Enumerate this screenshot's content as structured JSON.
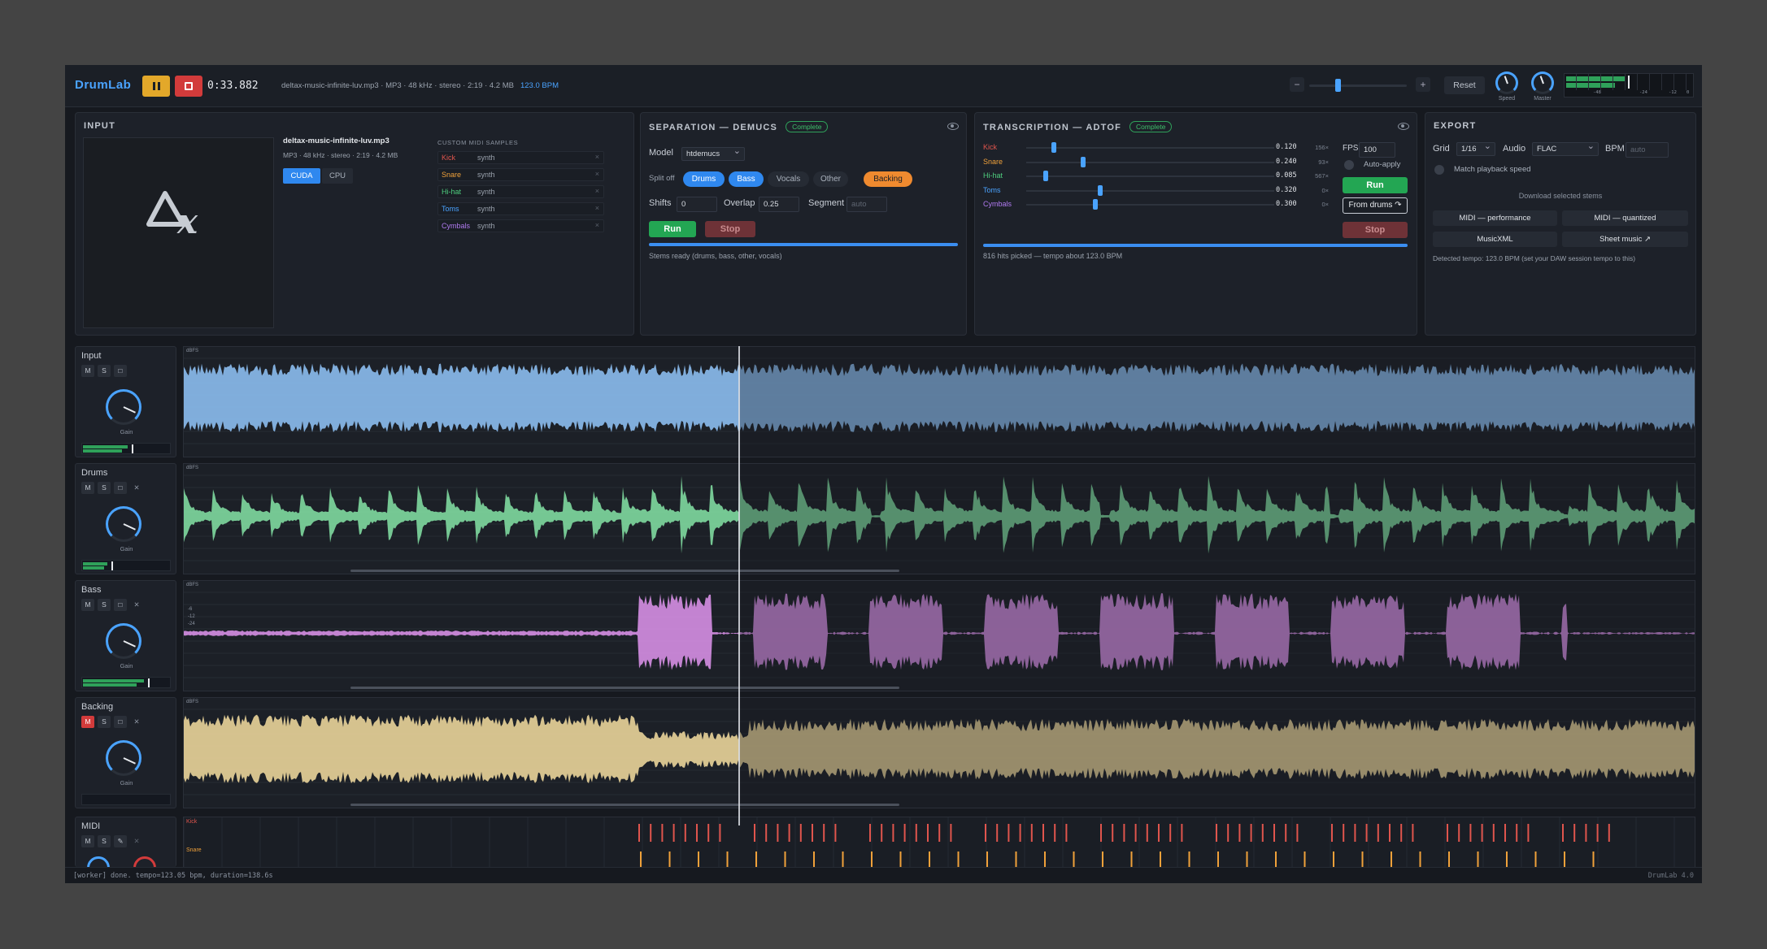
{
  "app": {
    "brand": "DrumLab",
    "time": "0:33.882",
    "file_info": "deltax-music-infinite-luv.mp3 · MP3 · 48 kHz · stereo · 2:19 · 4.2 MB",
    "bpm": "123.0 BPM",
    "reset": "Reset",
    "zoom_minus": "−",
    "zoom_plus": "+",
    "speed_label": "Speed",
    "master_label": "Master",
    "meter_ticks": [
      "-48",
      "-24",
      "-12",
      "0"
    ]
  },
  "input": {
    "title": "INPUT",
    "filename": "deltax-music-infinite-luv.mp3",
    "meta": "MP3 · 48 kHz · stereo · 2:19 · 4.2 MB",
    "cuda": "CUDA",
    "cpu": "CPU",
    "logo_text": "Δx",
    "samples_title": "CUSTOM MIDI SAMPLES",
    "samples": [
      {
        "name": "Kick",
        "value": "synth",
        "color": "#e0554d"
      },
      {
        "name": "Snare",
        "value": "synth",
        "color": "#f0a13a"
      },
      {
        "name": "Hi-hat",
        "value": "synth",
        "color": "#4fd07f"
      },
      {
        "name": "Toms",
        "value": "synth",
        "color": "#4aa3ff"
      },
      {
        "name": "Cymbals",
        "value": "synth",
        "color": "#b07af0"
      }
    ]
  },
  "separation": {
    "title": "SEPARATION — DEMUCS",
    "status": "Complete",
    "model_label": "Model",
    "model": "htdemucs",
    "split_label": "Split off",
    "splits": [
      "Drums",
      "Bass",
      "Vocals",
      "Other",
      "Backing"
    ],
    "shifts_label": "Shifts",
    "shifts": "0",
    "overlap_label": "Overlap",
    "overlap": "0.25",
    "segment_label": "Segment",
    "segment_ph": "auto",
    "run": "Run",
    "stop": "Stop",
    "progress": 1.0,
    "note": "Stems ready (drums, bass, other, vocals)"
  },
  "transcription": {
    "title": "TRANSCRIPTION — ADTOF",
    "status": "Complete",
    "rows": [
      {
        "name": "Kick",
        "value": "0.120",
        "hits": "156×",
        "color": "#e0554d",
        "pos": 0.1
      },
      {
        "name": "Snare",
        "value": "0.240",
        "hits": "93×",
        "color": "#f0a13a",
        "pos": 0.22
      },
      {
        "name": "Hi-hat",
        "value": "0.085",
        "hits": "567×",
        "color": "#4fd07f",
        "pos": 0.07
      },
      {
        "name": "Toms",
        "value": "0.320",
        "hits": "0×",
        "color": "#4aa3ff",
        "pos": 0.29
      },
      {
        "name": "Cymbals",
        "value": "0.300",
        "hits": "0×",
        "color": "#b07af0",
        "pos": 0.27
      }
    ],
    "fps_label": "FPS",
    "fps": "100",
    "auto_apply": "Auto-apply",
    "run": "Run",
    "from_drums": "From drums ↷",
    "stop": "Stop",
    "progress": 1.0,
    "note": "816 hits picked — tempo about 123.0 BPM"
  },
  "export": {
    "title": "EXPORT",
    "grid_label": "Grid",
    "grid": "1/16",
    "audio_label": "Audio",
    "audio": "FLAC",
    "bpm_label": "BPM",
    "bpm_ph": "auto",
    "match": "Match playback speed",
    "download": "Download selected stems",
    "buttons": [
      "MIDI — performance",
      "MIDI — quantized",
      "MusicXML",
      "Sheet music ↗"
    ],
    "detected": "Detected tempo: 123.0 BPM (set your DAW session tempo to this)"
  },
  "tracks": [
    {
      "name": "Input",
      "color": "#8cbcf0",
      "gain": "Gain",
      "buttons": [
        "M",
        "S",
        "□"
      ],
      "muted": false
    },
    {
      "name": "Drums",
      "color": "#7fd9a0",
      "gain": "Gain",
      "buttons": [
        "M",
        "S",
        "□",
        "✕"
      ],
      "muted": false
    },
    {
      "name": "Bass",
      "color": "#d68ee4",
      "gain": "Gain",
      "buttons": [
        "M",
        "S",
        "□",
        "✕"
      ],
      "muted": false
    },
    {
      "name": "Backing",
      "color": "#ead49a",
      "gain": "Gain",
      "buttons": [
        "M",
        "S",
        "□",
        "✕"
      ],
      "muted": true
    }
  ],
  "lane_labels": {
    "dbfs": "dBFS",
    "bass_ticks": [
      "-6",
      "-12",
      "-24"
    ]
  },
  "midi": {
    "name": "MIDI",
    "buttons": [
      "M",
      "S",
      "✎",
      "✕"
    ],
    "rows": [
      {
        "name": "Kick",
        "color": "#e0554d"
      },
      {
        "name": "Snare",
        "color": "#f0a13a"
      }
    ]
  },
  "status": {
    "left": "[worker] done. tempo=123.05 bpm, duration=138.6s",
    "right": "DrumLab 4.0"
  }
}
